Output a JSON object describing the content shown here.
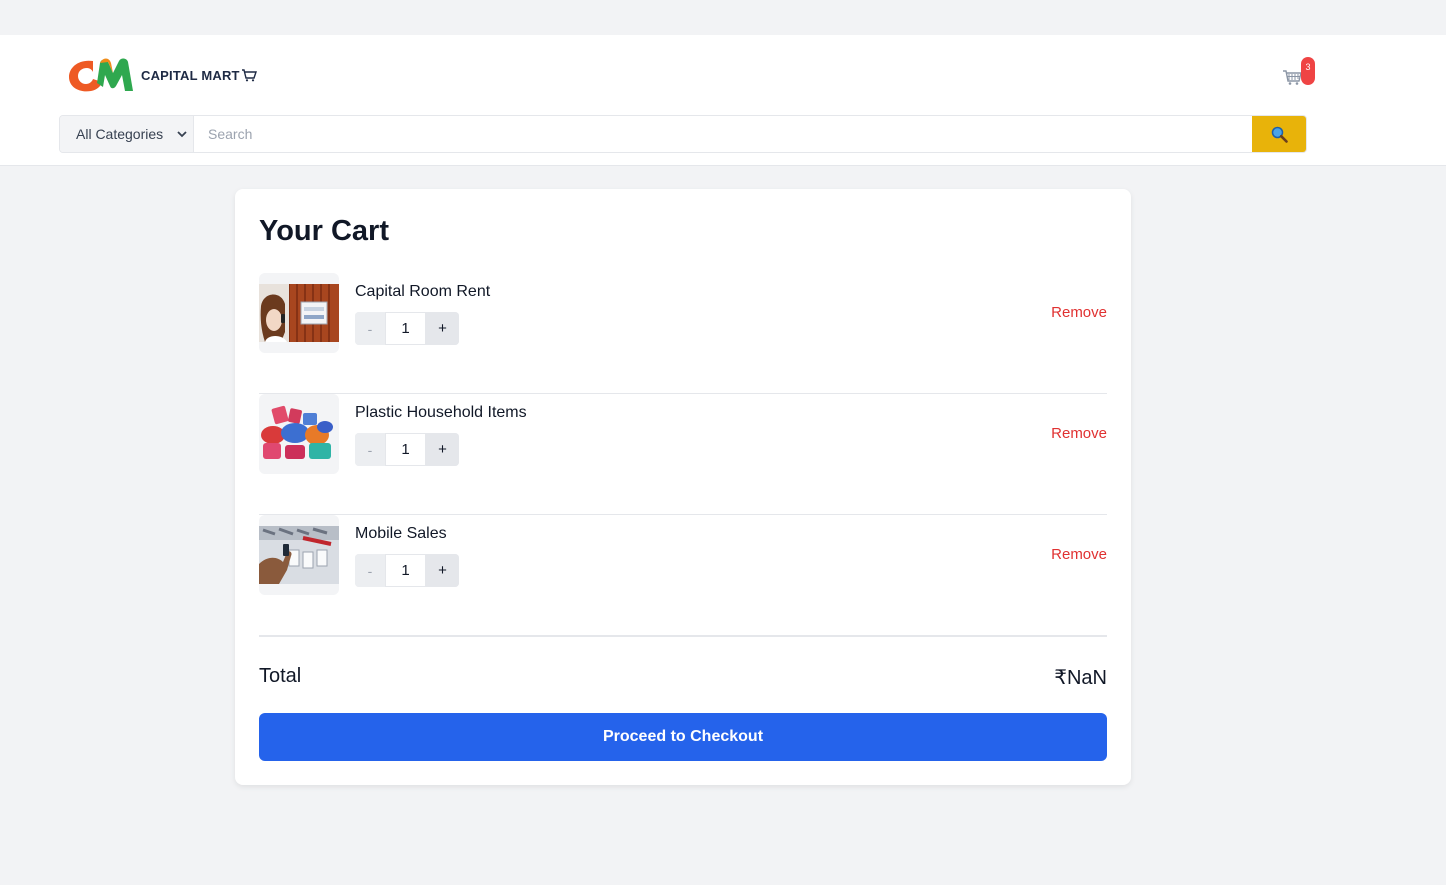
{
  "brand": {
    "name": "CAPITAL MART",
    "logo_icon": "cm-logo-icon"
  },
  "header": {
    "cart_count": "3"
  },
  "search": {
    "category": "All Categories",
    "placeholder": "Search"
  },
  "cart": {
    "title": "Your Cart",
    "items": [
      {
        "name": "Capital Room Rent",
        "qty": "1",
        "minus": "-",
        "plus": "+",
        "remove": "Remove"
      },
      {
        "name": "Plastic Household Items",
        "qty": "1",
        "minus": "-",
        "plus": "+",
        "remove": "Remove"
      },
      {
        "name": "Mobile Sales",
        "qty": "1",
        "minus": "-",
        "plus": "+",
        "remove": "Remove"
      }
    ],
    "total_label": "Total",
    "total_value": "₹NaN",
    "checkout_label": "Proceed to Checkout"
  },
  "colors": {
    "accent": "#2563eb",
    "search_button": "#e8b30a",
    "remove": "#e03131",
    "badge": "#ef4444"
  }
}
